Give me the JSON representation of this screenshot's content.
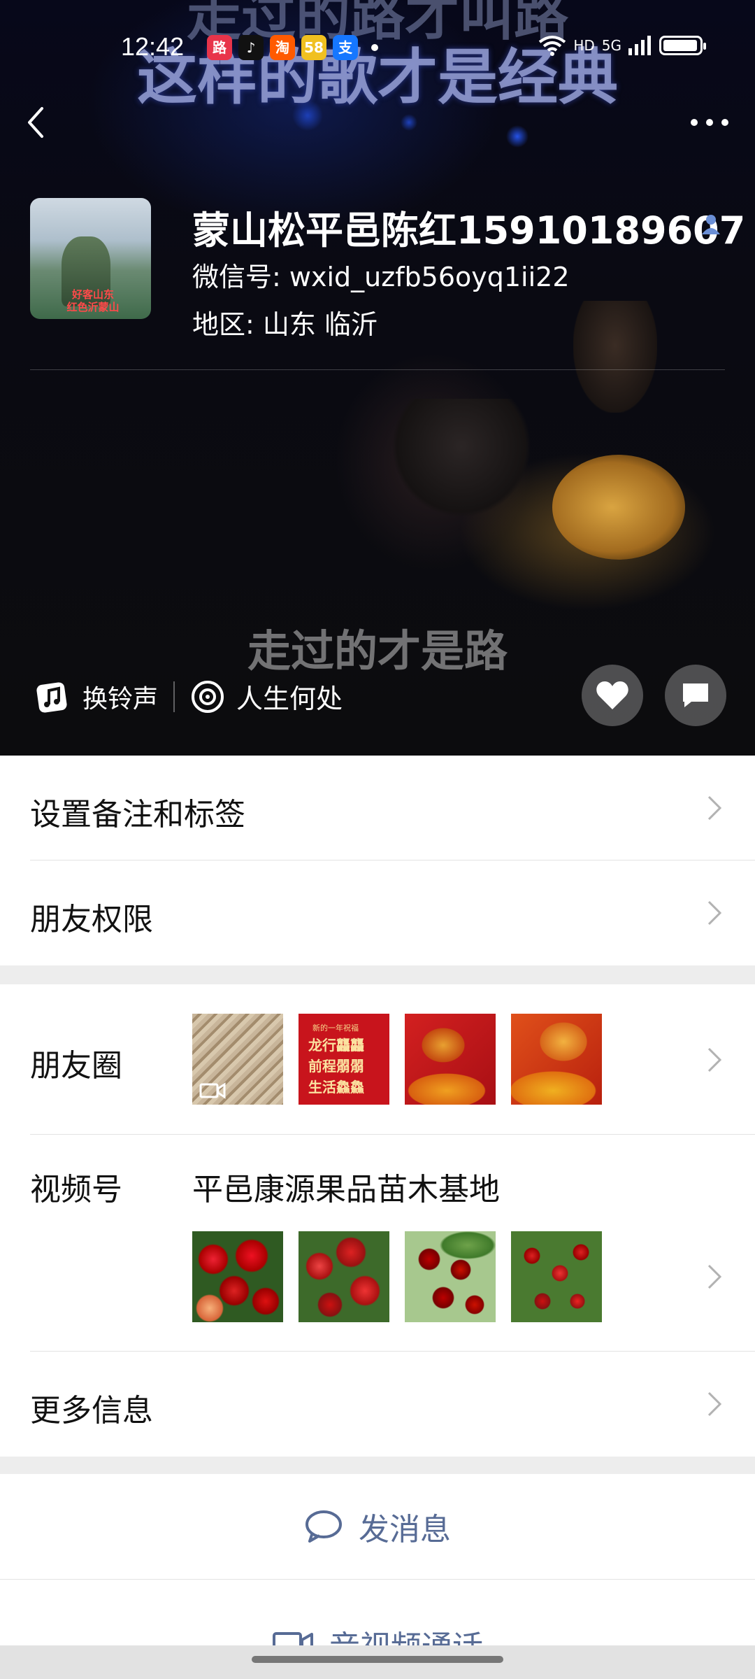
{
  "status_bar": {
    "time": "12:42",
    "app_badges": [
      {
        "icon": "lion-app-icon",
        "char": "路",
        "color": "#e8344a"
      },
      {
        "icon": "tiktok-app-icon",
        "char": "♪",
        "color": "#111111"
      },
      {
        "icon": "taobao-app-icon",
        "char": "淘",
        "color": "#ff5a00"
      },
      {
        "icon": "58-app-icon",
        "char": "58",
        "color": "#f0c020"
      },
      {
        "icon": "alipay-app-icon",
        "char": "支",
        "color": "#1677ff"
      }
    ],
    "hd_label": "HD",
    "network_label": "5G",
    "battery_level": 0.95
  },
  "hero": {
    "lyric_faded": "走过的路才叫路",
    "lyric_main": "这样的歌才是经典",
    "lyric_bottom": "走过的才是路"
  },
  "profile": {
    "name": "蒙山松平邑陈红15910189607",
    "wechat_id": "微信号: wxid_uzfb56oyq1ii22",
    "region": "地区: 山东  临沂",
    "avatar_caption": "好客山东\n红色沂蒙山"
  },
  "hero_actions": {
    "ringtone_label": "换铃声",
    "song_label": "人生何处"
  },
  "menu": {
    "remark_tags": "设置备注和标签",
    "friend_permissions": "朋友权限",
    "moments": "朋友圈",
    "channels": "视频号",
    "channel_name": "平邑康源果品苗木基地",
    "more_info": "更多信息"
  },
  "moments_thumbs": [
    {
      "name": "moment-thumb-video-sand",
      "text": ""
    },
    {
      "name": "moment-thumb-red-greeting",
      "text": "龙行龘龘\n前程朤朤\n生活鱻鱻",
      "small": "新的一年祝福"
    },
    {
      "name": "moment-thumb-dragon",
      "text": ""
    },
    {
      "name": "moment-thumb-dragon-2",
      "text": ""
    }
  ],
  "actions": {
    "send_message": "发消息",
    "video_call": "音视频通话"
  },
  "colors": {
    "link_blue": "#576b95",
    "verify_blue": "#6b8fd6",
    "divider": "#e3e3e3",
    "section_gap": "#ededed"
  }
}
